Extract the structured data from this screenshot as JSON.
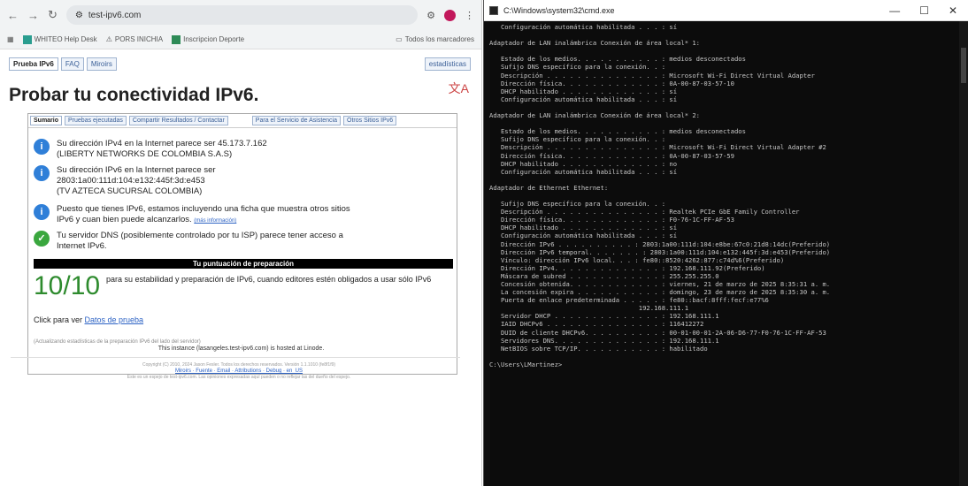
{
  "browser": {
    "url": "test-ipv6.com",
    "bookmarks": [
      "WHITEO Help Desk",
      "PORS INICHIA",
      "Inscripcion Deporte",
      "Todos los marcadores"
    ],
    "tabs": [
      "Prueba IPv6",
      "FAQ",
      "Miroirs"
    ],
    "stats_label": "estadísticas",
    "title": "Probar tu conectividad IPv6.",
    "subtabs": [
      "Sumario",
      "Pruebas ejecutadas",
      "Compartir Resultados / Contactar",
      "Para el Servicio de Asistencia",
      "Otros Sitios IPv6"
    ],
    "items": [
      {
        "icon": "info",
        "text": "Su dirección IPv4 en la Internet parece ser 45.173.7.162",
        "text2": "(LIBERTY NETWORKS DE COLOMBIA S.A.S)"
      },
      {
        "icon": "info",
        "text": "Su dirección IPv6 en la Internet parece ser",
        "text2": "2803:1a00:111d:104:e132:445f:3d:e453",
        "text3": "(TV AZTECA SUCURSAL COLOMBIA)"
      },
      {
        "icon": "info",
        "text": "Puesto que tienes IPv6, estamos incluyendo una ficha que muestra otros sitios",
        "text2": "IPv6 y cuan bien puede alcanzarlos.",
        "link": "(más información)"
      },
      {
        "icon": "ok",
        "text": "Tu servidor DNS (posiblemente controlado por tu ISP) parece tener acceso a",
        "text2": "Internet IPv6."
      }
    ],
    "score_header": "Tu puntuación de preparación",
    "score": "10/10",
    "score_text": "para su estabilidad y preparación de IPv6, cuando editores estén obligados a usar sólo IPv6",
    "click_prefix": "Click para ver ",
    "click_link": "Datos de prueba",
    "note": "(Actualizando estadísticas de la preparación IPv6 del lado del servidor)",
    "hosted": "This instance (lasangeles.test-ipv6.com) is hosted at Linode.",
    "footer_line1": "Copyright (C) 2010, 2024 Jason Fesler. Todos los derechos reservados. Versión 1.1.1010 (fe8f1f9)",
    "footer_links": "Miroirs · Fuente · Email · Attributions · Debug · en_US",
    "footer_line3": "Este es un espejo de test-ipv6.com. Las opiniones expresadas aquí pueden o no reflejar las del dueño del espejo."
  },
  "console": {
    "title": "C:\\Windows\\system32\\cmd.exe",
    "buttons": [
      "—",
      "☐",
      "✕"
    ],
    "lines": [
      "   Configuración automática habilitada . . . : sí",
      "",
      "Adaptador de LAN inalámbrica Conexión de área local* 1:",
      "",
      "   Estado de los medios. . . . . . . . . . . : medios desconectados",
      "   Sufijo DNS específico para la conexión. . :",
      "   Descripción . . . . . . . . . . . . . . . : Microsoft Wi-Fi Direct Virtual Adapter",
      "   Dirección física. . . . . . . . . . . . . : 0A-00-87-03-57-10",
      "   DHCP habilitado . . . . . . . . . . . . . : sí",
      "   Configuración automática habilitada . . . : sí",
      "",
      "Adaptador de LAN inalámbrica Conexión de área local* 2:",
      "",
      "   Estado de los medios. . . . . . . . . . . : medios desconectados",
      "   Sufijo DNS específico para la conexión. . :",
      "   Descripción . . . . . . . . . . . . . . . : Microsoft Wi-Fi Direct Virtual Adapter #2",
      "   Dirección física. . . . . . . . . . . . . : 0A-00-87-03-57-59",
      "   DHCP habilitado . . . . . . . . . . . . . : no",
      "   Configuración automática habilitada . . . : sí",
      "",
      "Adaptador de Ethernet Ethernet:",
      "",
      "   Sufijo DNS específico para la conexión. . :",
      "   Descripción . . . . . . . . . . . . . . . : Realtek PCIe GbE Family Controller",
      "   Dirección física. . . . . . . . . . . . . : F0-76-1C-FF-AF-53",
      "   DHCP habilitado . . . . . . . . . . . . . : sí",
      "   Configuración automática habilitada . . . : sí",
      "   Dirección IPv6 . . . . . . . . . . : 2803:1a00:111d:104:e8be:67c0:21d8:14dc(Preferido)",
      "   Dirección IPv6 temporal. . . . . . . : 2803:1a00:111d:104:e132:445f:3d:e453(Preferido)",
      "   Vínculo: dirección IPv6 local. . . : fe80::8520:4262:877:c74d%6(Preferido)",
      "   Dirección IPv4. . . . . . . . . . . . . . : 192.168.111.92(Preferido)",
      "   Máscara de subred . . . . . . . . . . . . : 255.255.255.0",
      "   Concesión obtenida. . . . . . . . . . . . : viernes, 21 de marzo de 2025 8:35:31 a. m.",
      "   La concesión expira . . . . . . . . . . . : domingo, 23 de marzo de 2025 8:35:30 a. m.",
      "   Puerta de enlace predeterminada . . . . . : fe80::bacf:8fff:fecf:e77%6",
      "                                       192.168.111.1",
      "   Servidor DHCP . . . . . . . . . . . . . . : 192.168.111.1",
      "   IAID DHCPv6 . . . . . . . . . . . . . . . : 116412272",
      "   DUID de cliente DHCPv6. . . . . . . . . . : 00-01-00-01-2A-06-D6-77-F0-76-1C-FF-AF-53",
      "   Servidores DNS. . . . . . . . . . . . . . : 192.168.111.1",
      "   NetBIOS sobre TCP/IP. . . . . . . . . . . : habilitado",
      "",
      "C:\\Users\\LMartinez>"
    ]
  }
}
